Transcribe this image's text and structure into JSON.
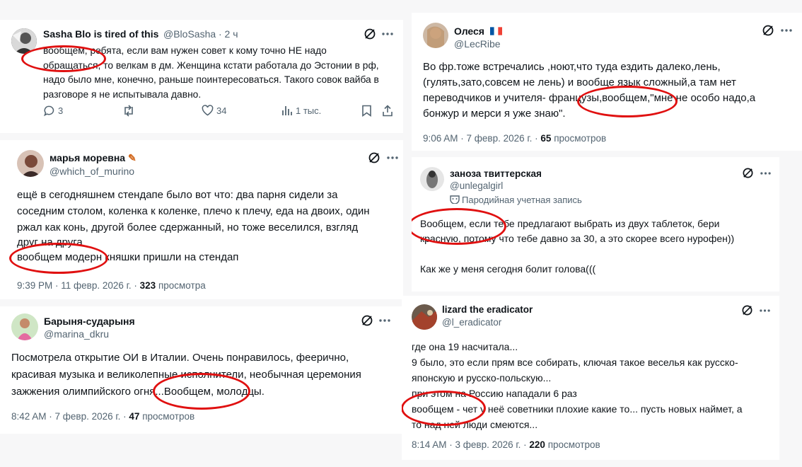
{
  "tweets": [
    {
      "name": "Sasha Blo is tired of this",
      "handle": "@BloSasha",
      "time": "· 2 ч",
      "lines": [
        "вообщем, ребята, если вам нужен совет к кому точно НЕ надо",
        "обращаться, то велкам в дм. Женщина кстати работала до Эстонии в рф,",
        "надо было мне, конечно, раньше поинтересоваться. Такого совок вайба в",
        "разговоре я не испытывала давно."
      ],
      "replies": "3",
      "likes": "34",
      "views": "1 тыс."
    },
    {
      "name": "Олеся",
      "handle": "@LecRibe",
      "lines": [
        "Во фр.тоже встречались ,ноют,что туда ездить далеко,лень,",
        "(гулять,зато,совсем не лень) и вообще язык сложный,а там нет",
        "переводчиков и учителя- французы,вообщем,\"мне не особо надо,а",
        "бонжур и мерси я уже знаю\"."
      ],
      "date": "9:06 AM · 7 февр. 2026 г. ·",
      "views_count": "65",
      "views_label": "просмотров"
    },
    {
      "name": "марья моревна",
      "handle": "@which_of_murino",
      "lines": [
        "ещё в сегодняшнем стендапе было вот что: два парня сидели за",
        "соседним столом, коленка к коленке, плечо к плечу, еда на двоих, один",
        "ржал как конь, другой более сдержанный, но тоже веселился, взгляд",
        "друг на друга",
        "вообщем модерн княшки пришли на стендап"
      ],
      "date": "9:39 PM · 11 февр. 2026 г. ·",
      "views_count": "323",
      "views_label": "просмотра"
    },
    {
      "name": "заноза твиттерская",
      "handle": "@unlegalgirl",
      "parody": "Пародийная учетная запись",
      "lines": [
        "Вообщем, если тебе предлагают выбрать из двух таблеток, бери",
        "красную, потому что тебе давно за 30, а это скорее всего нурофен))",
        "",
        "Как же у меня сегодня болит голова((("
      ]
    },
    {
      "name": "Барыня-сударыня",
      "handle": "@marina_dkru",
      "lines": [
        "Посмотрела открытие ОИ в Италии. Очень понравилось, феерично,",
        "красивая музыка и великолепные исполнители, необычная церемония",
        "зажжения олимпийского огня...Вообщем, молодцы."
      ],
      "date": "8:42 AM · 7 февр. 2026 г. ·",
      "views_count": "47",
      "views_label": "просмотров"
    },
    {
      "name": "lizard the eradicator",
      "handle": "@l_eradicator",
      "lines": [
        "где она 19 насчитала...",
        "9 было, это если прям все собирать, ключая такое веселья как русско-",
        "японскую и русско-польскую...",
        "при этом на Россию нападали 6 раз",
        "вообщем - чет у неё советники плохие какие то... пусть новых наймет, а",
        "то над ней люди смеются..."
      ],
      "date": "8:14 AM · 3 февр. 2026 г. ·",
      "views_count": "220",
      "views_label": "просмотров"
    }
  ],
  "colors": {
    "highlight": "#e01010",
    "muted": "#536471",
    "text": "#0f1419"
  },
  "icons": [
    "grok-icon",
    "more-icon",
    "reply-icon",
    "retweet-icon",
    "like-icon",
    "views-icon",
    "bookmark-icon",
    "share-icon",
    "parody-mask-icon",
    "france-flag-icon",
    "paint-brush-emoji-icon"
  ]
}
